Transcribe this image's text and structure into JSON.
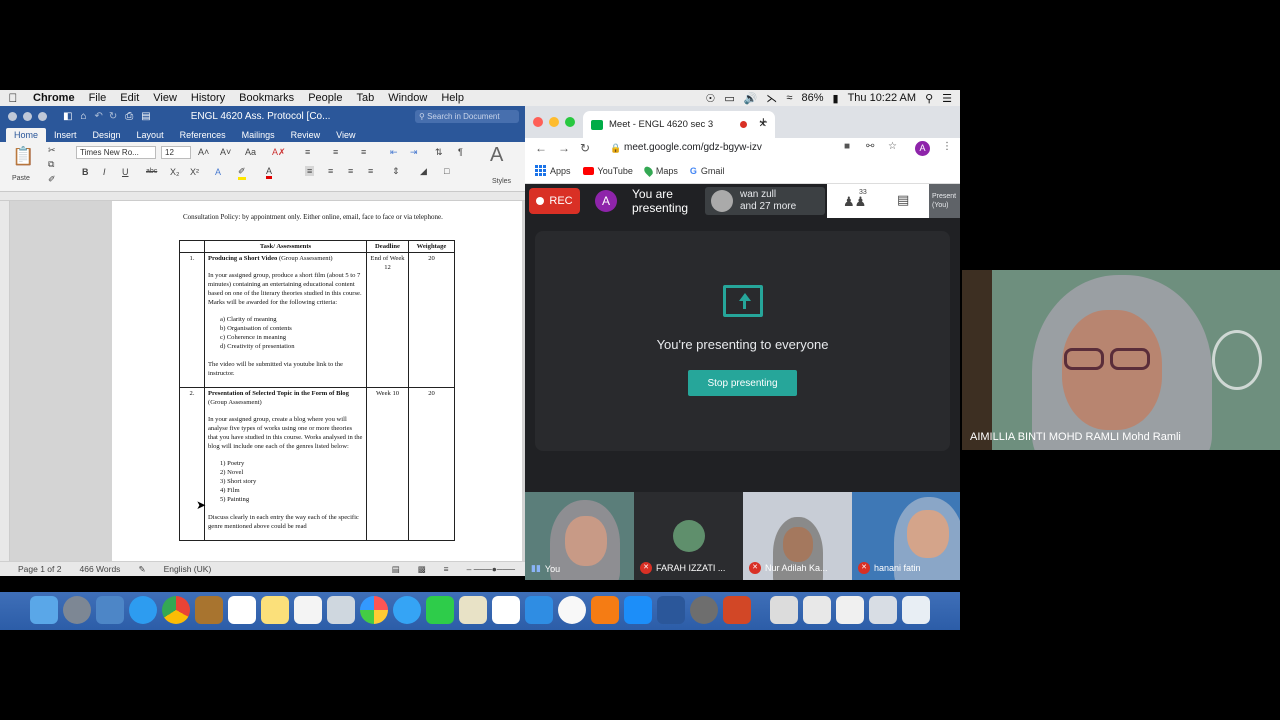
{
  "menubar": {
    "app": "Chrome",
    "items": [
      "File",
      "Edit",
      "View",
      "History",
      "Bookmarks",
      "People",
      "Tab",
      "Window",
      "Help"
    ],
    "battery": "86%",
    "clock": "Thu 10:22 AM"
  },
  "word": {
    "title": "ENGL 4620 Ass. Protocol [Co...",
    "search_placeholder": "Search in Document",
    "tabs": [
      "Home",
      "Insert",
      "Design",
      "Layout",
      "References",
      "Mailings",
      "Review",
      "View"
    ],
    "font_name": "Times New Ro...",
    "font_size": "12",
    "paste_label": "Paste",
    "styles_label": "Styles",
    "document": {
      "consultation": "Consultation Policy: by appointment only. Either online, email, face to face or via telephone.",
      "headers": [
        "Task/ Assessments",
        "Deadline",
        "Weightage"
      ],
      "rows": [
        {
          "num": "1.",
          "title_bold": "Producing a Short Video",
          "title_rest": " (Group Assessment)",
          "para1": "In your assigned group, produce a short film (about 5 to 7 minutes) containing an entertaining educational content based on one of the literary theories studied in this course. Marks will be awarded for the following criteria:",
          "list": [
            "a)   Clarity of meaning",
            "b)   Organisation of contents",
            "c)   Coherence in meaning",
            "d)   Creativity of presentation"
          ],
          "para2": "The video will be submitted via youtube link to the instructor.",
          "deadline": "End of Week 12",
          "weight": "20"
        },
        {
          "num": "2.",
          "title_bold": "Presentation of Selected Topic in the Form of Blog",
          "title_rest": " (Group Assessment)",
          "para1": "In your assigned group, create a blog where you will analyse five types of works using one or more theories that you have studied in this course. Works analysed in the blog will include one each of the genres listed below:",
          "list": [
            "1)   Poetry",
            "2)   Novel",
            "3)   Short story",
            "4)   Film",
            "5)   Painting"
          ],
          "para2": "Discuss clearly in each entry the way each of the specific genre mentioned above could be read",
          "deadline": "Week 10",
          "weight": "20"
        }
      ]
    },
    "status": {
      "page": "Page 1 of 2",
      "words": "466 Words",
      "language": "English (UK)"
    }
  },
  "chrome": {
    "tab_title": "Meet - ENGL 4620 sec 3",
    "url": "meet.google.com/gdz-bgyw-izv",
    "bookmarks": [
      "Apps",
      "YouTube",
      "Maps",
      "Gmail"
    ],
    "profile_initial": "A"
  },
  "meet": {
    "rec_label": "REC",
    "presenter_initial": "A",
    "presenting_label": "You are presenting",
    "others_name": "wan zull",
    "others_more": "and 27 more",
    "participant_count": "33",
    "present_you": "Present (You)",
    "share_message": "You're presenting to everyone",
    "stop_button": "Stop presenting",
    "tiles": [
      "You",
      "FARAH IZZATI ...",
      "Nur Adilah Ka...",
      "hanani fatin"
    ],
    "main_speaker": "AIMILLIA BINTI MOHD RAMLI Mohd Ramli"
  },
  "colors": {
    "word_blue": "#2b579a",
    "meet_teal": "#26a69a",
    "rec_red": "#d93025"
  }
}
